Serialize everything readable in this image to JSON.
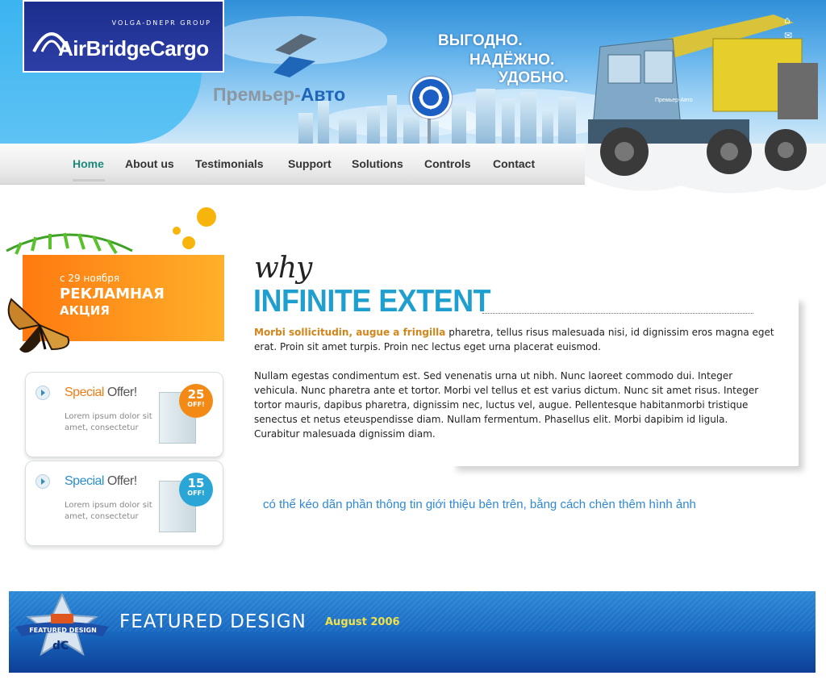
{
  "header": {
    "logo_airbridge": {
      "group": "VOLGA-DNEPR GROUP",
      "name": "AirBridgeCargo"
    },
    "logo_premier": {
      "part1": "Премьер-",
      "part2": "Авто"
    },
    "slogans": [
      "ВЫГОДНО.",
      "НАДЁЖНО.",
      "УДОБНО."
    ],
    "truck_label": "Премьер-Авто",
    "top_icons": [
      "home-icon",
      "mail-icon"
    ]
  },
  "nav": {
    "items": [
      {
        "label": "Home"
      },
      {
        "label": "About us"
      },
      {
        "label": "Testimonials"
      },
      {
        "label": "Support"
      },
      {
        "label": "Solutions"
      },
      {
        "label": "Controls"
      },
      {
        "label": "Contact"
      }
    ],
    "active": "Home"
  },
  "promo": {
    "date_line": "с 29 ноября",
    "title_line1": "РЕКЛАМНАЯ",
    "title_line2": "АКЦИЯ"
  },
  "offers": [
    {
      "title_a": "Special",
      "title_b": " Offer!",
      "desc": "Lorem ipsum dolor sit amet, consectetur",
      "discount": "25",
      "badge_word": "OFF!"
    },
    {
      "title_a": "Special",
      "title_b": " Offer!",
      "desc": "Lorem ipsum dolor sit amet, consectetur",
      "discount": "15",
      "badge_word": "OFF!"
    }
  ],
  "main": {
    "why": "why",
    "headline": "INFINITE EXTENT",
    "lead": "Morbi sollicitudin, augue a fringilla",
    "para1_rest": " pharetra, tellus risus malesuada nisi, id dignissim eros magna eget erat. Proin sit amet turpis. Proin nec lectus eget urna placerat euismod.",
    "para2": "Nullam egestas condimentum est. Sed venenatis urna ut nibh. Nunc laoreet commodo dui. Integer vehicula. Nunc pharetra ante et tortor. Morbi vel tellus et est varius dictum. Nunc sit amet risus. Integer tortor mauris, dapibus pharetra, dignissim nec, luctus vel, augue. Pellentesque habitanmorbi tristique senectus et netus eteuspendisse diam. Nullam fermentum. Phasellus elit. Morbi dapibim id ligula. Curabitur malesuada dignissim diam.",
    "note": "có thể kéo dãn phần thông tin giới thiệu bên trên, bằng cách chèn thêm hình ảnh"
  },
  "featured": {
    "title": "FEATURED DESIGN",
    "date": "August 2006",
    "badge_label": "FEATURED DESIGN",
    "badge_mark": "dC"
  },
  "colors": {
    "accent": "#1e9fcf",
    "nav_active": "#1e8a7a",
    "lead": "#d2851a",
    "link": "#2e88d6"
  }
}
